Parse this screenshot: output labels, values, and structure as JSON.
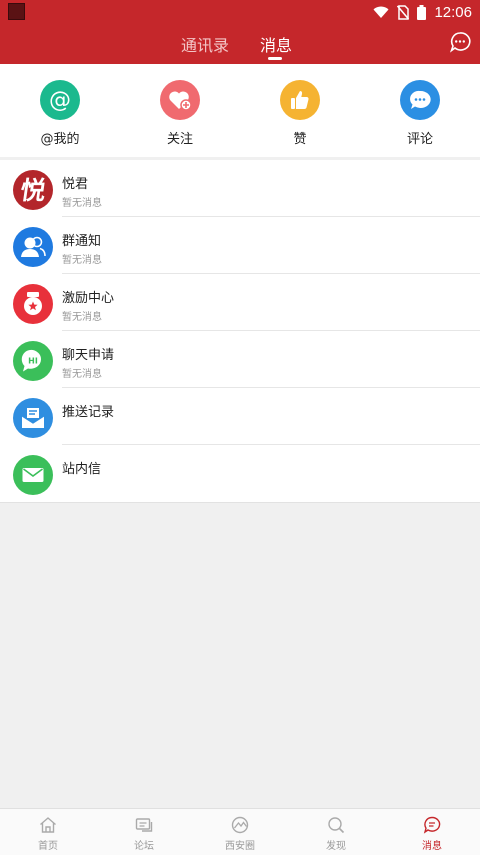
{
  "status_bar": {
    "time": "12:06"
  },
  "header": {
    "tabs": [
      {
        "label": "通讯录",
        "active": false
      },
      {
        "label": "消息",
        "active": true
      }
    ]
  },
  "quick_actions": [
    {
      "label": "@我的",
      "icon": "at-icon",
      "color": "#1bb98e"
    },
    {
      "label": "关注",
      "icon": "heart-plus-icon",
      "color": "#f06a6f"
    },
    {
      "label": "赞",
      "icon": "thumbs-up-icon",
      "color": "#f5b332"
    },
    {
      "label": "评论",
      "icon": "comment-icon",
      "color": "#2b8fe3"
    }
  ],
  "messages": [
    {
      "title": "悦君",
      "subtitle": "暂无消息",
      "icon": "yuejun-logo"
    },
    {
      "title": "群通知",
      "subtitle": "暂无消息",
      "icon": "group-icon"
    },
    {
      "title": "激励中心",
      "subtitle": "暂无消息",
      "icon": "medal-icon"
    },
    {
      "title": "聊天申请",
      "subtitle": "暂无消息",
      "icon": "chat-hi-icon"
    },
    {
      "title": "推送记录",
      "subtitle": "",
      "icon": "inbox-icon"
    },
    {
      "title": "站内信",
      "subtitle": "",
      "icon": "mail-icon"
    }
  ],
  "logo_text": "悦",
  "chat_badge_text": "HI",
  "bottom_nav": [
    {
      "label": "首页",
      "icon": "home-icon",
      "active": false
    },
    {
      "label": "论坛",
      "icon": "forum-icon",
      "active": false
    },
    {
      "label": "西安圈",
      "icon": "circle-icon",
      "active": false
    },
    {
      "label": "发现",
      "icon": "discover-icon",
      "active": false
    },
    {
      "label": "消息",
      "icon": "message-icon",
      "active": true
    }
  ],
  "colors": {
    "brand": "#c5272b",
    "group": "#1f7ae0",
    "medal": "#e8313b",
    "chat": "#3bbf5a",
    "inbox": "#2f8ee0",
    "mail": "#3bbf5a"
  }
}
